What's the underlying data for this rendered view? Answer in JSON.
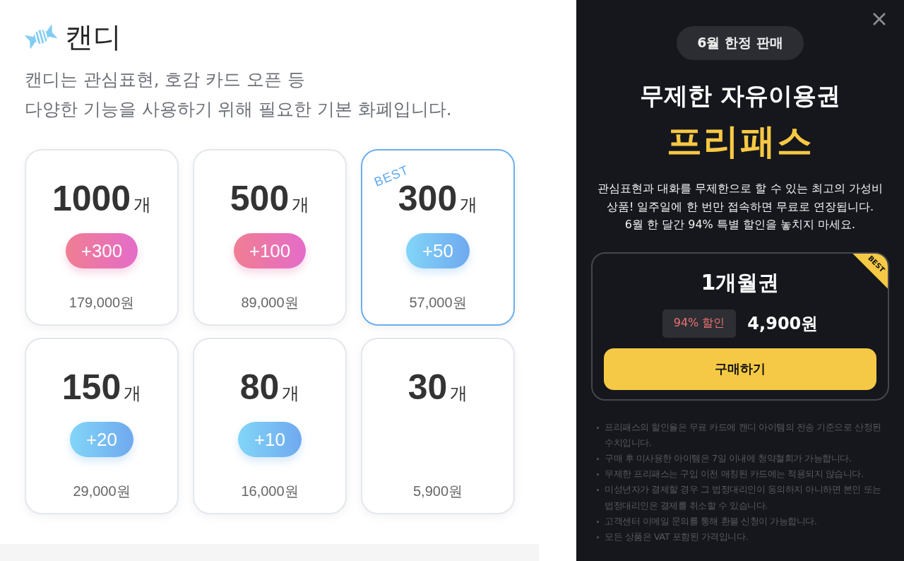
{
  "header": {
    "title": "캔디",
    "description_lines": [
      "캔디는 관심표현, 호감 카드 오픈 등",
      "다양한 기능을 사용하기 위해 필요한 기본 화폐입니다."
    ]
  },
  "packages": [
    {
      "count": "1000",
      "unit": "개",
      "bonus": {
        "label": "+300",
        "kind": "pink"
      },
      "price": "179,000원",
      "selected": false
    },
    {
      "count": "500",
      "unit": "개",
      "bonus": {
        "label": "+100",
        "kind": "pink"
      },
      "price": "89,000원",
      "selected": false
    },
    {
      "count": "300",
      "unit": "개",
      "badge": "BEST",
      "bonus": {
        "label": "+50",
        "kind": "blue"
      },
      "price": "57,000원",
      "selected": true
    },
    {
      "count": "150",
      "unit": "개",
      "bonus": {
        "label": "+20",
        "kind": "blue"
      },
      "price": "29,000원",
      "selected": false
    },
    {
      "count": "80",
      "unit": "개",
      "bonus": {
        "label": "+10",
        "kind": "blue"
      },
      "price": "16,000원",
      "selected": false
    },
    {
      "count": "30",
      "unit": "개",
      "price": "5,900원",
      "selected": false
    }
  ],
  "promo_panel": {
    "tag": "6월 한정 판매",
    "title": "무제한 자유이용권",
    "product_name": "프리패스",
    "description_lines": [
      "관심표현과 대화를 무제한으로 할 수 있는 최고의 가성비",
      "상품! 일주일에 한 번만 접속하면 무료로 연장됩니다.",
      "6월 한 달간 94% 특별 할인을 놓치지 마세요."
    ],
    "plan": {
      "ribbon": "BEST",
      "name": "1개월권",
      "discount": "94% 할인",
      "price": "4,900원",
      "button": "구매하기"
    },
    "notes": [
      "프리패스의 할인율은 무료 카드에 캔디 아이템의 전송 기준으로 산정된 수치입니다.",
      "구매 후 미사용한 아이템은 7일 이내에 청약철회가 가능합니다.",
      "무제한 프리패스는 구입 이전 매칭된 카드에는 적용되지 않습니다.",
      "미성년자가 결제할 경우 그 법정대리인이 동의하지 아니하면 본인 또는 법정대리인은 결제를 취소할 수 있습니다.",
      "고객센터 이메일 문의를 통해 환불 신청이 가능합니다.",
      "모든 상품은 VAT 포함된 가격입니다."
    ]
  }
}
